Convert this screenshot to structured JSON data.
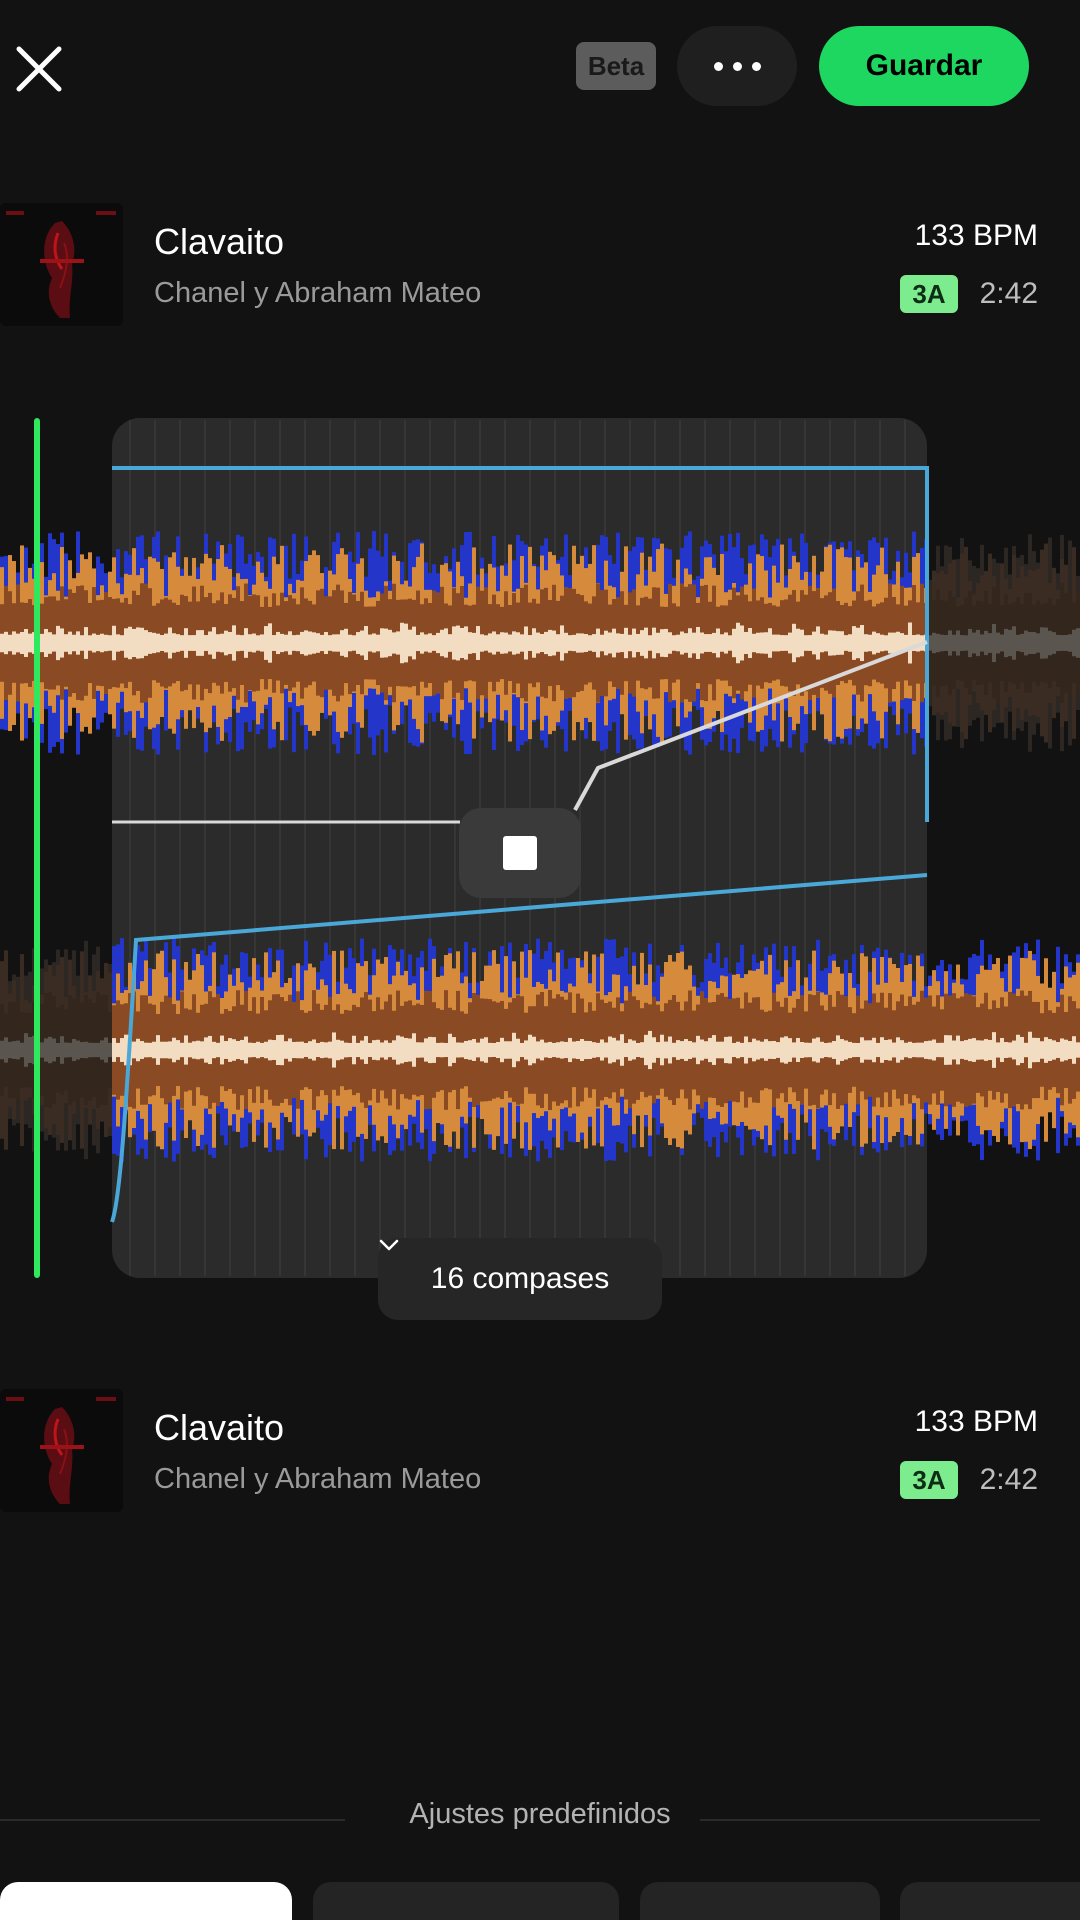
{
  "header": {
    "close_icon": "close-icon",
    "beta_label": "Beta",
    "more_icon": "more-horizontal-icon",
    "save_label": "Guardar",
    "accent_color": "#1ed760"
  },
  "tracks": [
    {
      "title": "Clavaito",
      "artist": "Chanel y Abraham Mateo",
      "bpm": "133 BPM",
      "key": "3A",
      "duration": "2:42"
    },
    {
      "title": "Clavaito",
      "artist": "Chanel y Abraham Mateo",
      "bpm": "133 BPM",
      "key": "3A",
      "duration": "2:42"
    }
  ],
  "editor": {
    "stop_icon": "stop-icon",
    "bars_label": "16 compases",
    "bars_dropdown_icon": "chevron-down-icon",
    "colors": {
      "playhead": "#2ee85e",
      "automation": "#4aa8d8",
      "crossfade": "#d9d9d9",
      "wave_blue": "#2336c9",
      "wave_orange": "#d68a3c",
      "wave_brown": "#8a4a23",
      "wave_core": "#f2dcc2"
    }
  },
  "presets": {
    "label": "Ajustes predefinidos"
  }
}
